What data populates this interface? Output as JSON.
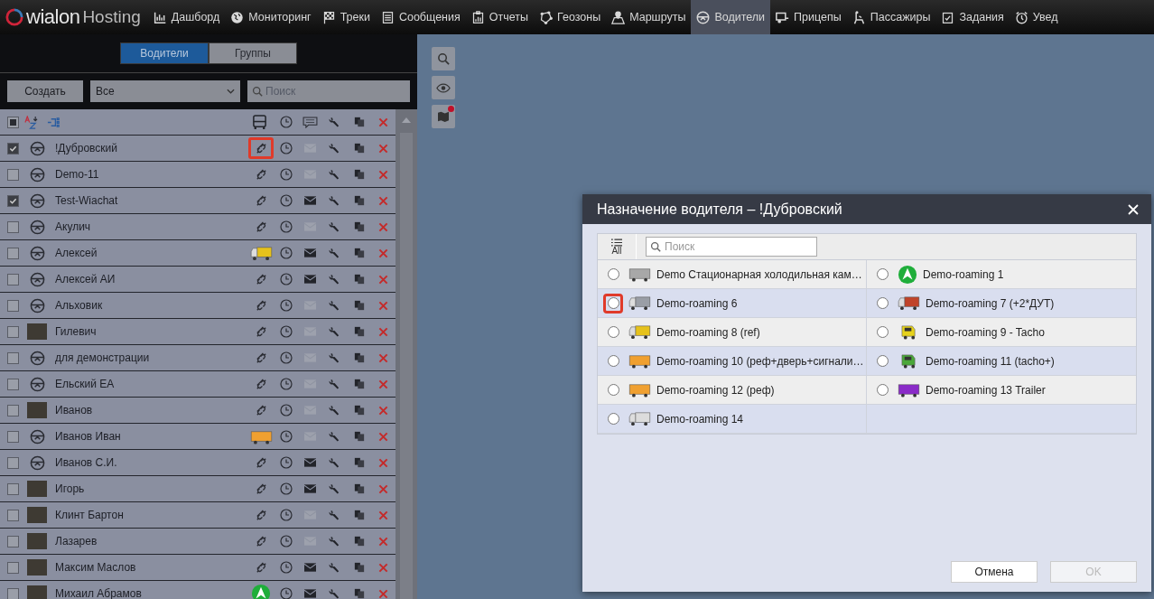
{
  "navbar": {
    "logo": {
      "brand": "wialon",
      "suffix": "Hosting"
    },
    "items": [
      {
        "label": "Дашборд",
        "kind": "chart",
        "selected": false
      },
      {
        "label": "Мониторинг",
        "kind": "globe",
        "selected": false
      },
      {
        "label": "Треки",
        "kind": "flag",
        "selected": false
      },
      {
        "label": "Сообщения",
        "kind": "doc",
        "selected": false
      },
      {
        "label": "Отчеты",
        "kind": "report",
        "selected": false
      },
      {
        "label": "Геозоны",
        "kind": "geo",
        "selected": false
      },
      {
        "label": "Маршруты",
        "kind": "route",
        "selected": false
      },
      {
        "label": "Водители",
        "kind": "wheel",
        "selected": true
      },
      {
        "label": "Прицепы",
        "kind": "trailer",
        "selected": false
      },
      {
        "label": "Пассажиры",
        "kind": "seat",
        "selected": false
      },
      {
        "label": "Задания",
        "kind": "task",
        "selected": false
      },
      {
        "label": "Увед",
        "kind": "alarm",
        "selected": false
      }
    ]
  },
  "left_panel": {
    "tabs": [
      {
        "label": "Водители",
        "selected": true
      },
      {
        "label": "Группы",
        "selected": false
      }
    ],
    "create_button": "Создать",
    "filter": {
      "value": "Все"
    },
    "search": {
      "placeholder": "Поиск"
    },
    "header": {
      "checked": false,
      "indeterminate": true
    },
    "rows": [
      {
        "name": "!Дубровский",
        "checked": true,
        "avatar": {
          "kind": "wheel"
        },
        "unit": {
          "kind": "link",
          "highlighted": true
        },
        "sms": {
          "enabled": false
        }
      },
      {
        "name": "Demo-11",
        "checked": false,
        "avatar": {
          "kind": "wheel"
        },
        "unit": {
          "kind": "link",
          "highlighted": false
        },
        "sms": {
          "enabled": false
        }
      },
      {
        "name": "Test-Wiachat",
        "checked": true,
        "avatar": {
          "kind": "wheel"
        },
        "unit": {
          "kind": "link",
          "highlighted": false
        },
        "sms": {
          "enabled": true
        }
      },
      {
        "name": "Акулич",
        "checked": false,
        "avatar": {
          "kind": "wheel"
        },
        "unit": {
          "kind": "link",
          "highlighted": false
        },
        "sms": {
          "enabled": false
        }
      },
      {
        "name": "Алексей",
        "checked": false,
        "avatar": {
          "kind": "wheel"
        },
        "unit": {
          "kind": "yellow-truck",
          "highlighted": false
        },
        "sms": {
          "enabled": true
        }
      },
      {
        "name": "Алексей АИ",
        "checked": false,
        "avatar": {
          "kind": "wheel"
        },
        "unit": {
          "kind": "link",
          "highlighted": false
        },
        "sms": {
          "enabled": true
        }
      },
      {
        "name": "Альховик",
        "checked": false,
        "avatar": {
          "kind": "wheel"
        },
        "unit": {
          "kind": "link",
          "highlighted": false
        },
        "sms": {
          "enabled": false
        }
      },
      {
        "name": "Гилевич",
        "checked": false,
        "avatar": {
          "kind": "photo"
        },
        "unit": {
          "kind": "link",
          "highlighted": false
        },
        "sms": {
          "enabled": false
        }
      },
      {
        "name": "для демонстрации",
        "checked": false,
        "avatar": {
          "kind": "wheel"
        },
        "unit": {
          "kind": "link",
          "highlighted": false
        },
        "sms": {
          "enabled": false
        }
      },
      {
        "name": "Ельский ЕА",
        "checked": false,
        "avatar": {
          "kind": "wheel"
        },
        "unit": {
          "kind": "link",
          "highlighted": false
        },
        "sms": {
          "enabled": false
        }
      },
      {
        "name": "Иванов",
        "checked": false,
        "avatar": {
          "kind": "photo"
        },
        "unit": {
          "kind": "link",
          "highlighted": false
        },
        "sms": {
          "enabled": false
        }
      },
      {
        "name": "Иванов Иван",
        "checked": false,
        "avatar": {
          "kind": "wheel"
        },
        "unit": {
          "kind": "orange-trailer",
          "highlighted": false
        },
        "sms": {
          "enabled": false
        }
      },
      {
        "name": "Иванов С.И.",
        "checked": false,
        "avatar": {
          "kind": "wheel"
        },
        "unit": {
          "kind": "link",
          "highlighted": false
        },
        "sms": {
          "enabled": true
        }
      },
      {
        "name": "Игорь",
        "checked": false,
        "avatar": {
          "kind": "photo"
        },
        "unit": {
          "kind": "link",
          "highlighted": false
        },
        "sms": {
          "enabled": true
        }
      },
      {
        "name": "Клинт Бартон",
        "checked": false,
        "avatar": {
          "kind": "photo"
        },
        "unit": {
          "kind": "link",
          "highlighted": false
        },
        "sms": {
          "enabled": false
        }
      },
      {
        "name": "Лазарев",
        "checked": false,
        "avatar": {
          "kind": "photo"
        },
        "unit": {
          "kind": "link",
          "highlighted": false
        },
        "sms": {
          "enabled": false
        }
      },
      {
        "name": "Максим Маслов",
        "checked": false,
        "avatar": {
          "kind": "photo"
        },
        "unit": {
          "kind": "link",
          "highlighted": false
        },
        "sms": {
          "enabled": true
        }
      },
      {
        "name": "Михаил Абрамов",
        "checked": false,
        "avatar": {
          "kind": "photo"
        },
        "unit": {
          "kind": "green-arrow",
          "highlighted": false
        },
        "sms": {
          "enabled": true
        }
      }
    ]
  },
  "dialog": {
    "title": "Назначение водителя – !Дубровский",
    "filter_label": "All",
    "search": {
      "placeholder": "Поиск"
    },
    "units": [
      {
        "name": "Demo Стационарная холодильная кам…",
        "kind": "container",
        "selected": false,
        "highlighted": false
      },
      {
        "name": "Demo-roaming 1",
        "kind": "green-arrow",
        "selected": false,
        "highlighted": false
      },
      {
        "name": "Demo-roaming 6",
        "kind": "grey-truck",
        "selected": false,
        "highlighted": true
      },
      {
        "name": "Demo-roaming 7 (+2*ДУТ)",
        "kind": "red-truck",
        "selected": false,
        "highlighted": false
      },
      {
        "name": "Demo-roaming 8 (ref)",
        "kind": "yellow-truck",
        "selected": false,
        "highlighted": false
      },
      {
        "name": "Demo-roaming 9 - Tacho",
        "kind": "yellow-tractor",
        "selected": false,
        "highlighted": false
      },
      {
        "name": "Demo-roaming 10 (реф+дверь+сигнали…",
        "kind": "orange-trailer",
        "selected": false,
        "highlighted": false
      },
      {
        "name": "Demo-roaming 11 (tacho+)",
        "kind": "green-tractor",
        "selected": false,
        "highlighted": false
      },
      {
        "name": "Demo-roaming 12 (реф)",
        "kind": "orange-trailer",
        "selected": false,
        "highlighted": false
      },
      {
        "name": "Demo-roaming 13 Trailer",
        "kind": "purple-trailer",
        "selected": false,
        "highlighted": false
      },
      {
        "name": "Demo-roaming 14",
        "kind": "white-truck",
        "selected": false,
        "highlighted": false
      }
    ],
    "buttons": [
      {
        "label": "Отмена",
        "disabled": false
      },
      {
        "label": "OK",
        "disabled": true
      }
    ]
  }
}
